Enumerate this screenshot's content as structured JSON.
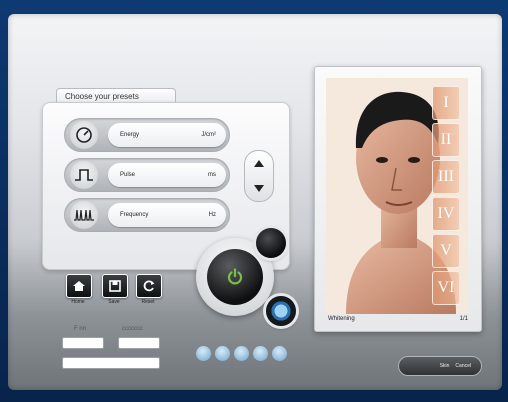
{
  "presets": {
    "tab_title": "Choose your presets",
    "rows": [
      {
        "icon": "gauge-icon",
        "label": "Energy",
        "value": "J/cm²"
      },
      {
        "icon": "pulse-wave-icon",
        "label": "Pulse",
        "value": "ms"
      },
      {
        "icon": "frequency-icon",
        "label": "Frequency",
        "value": "Hz"
      }
    ]
  },
  "nav": {
    "home_label": "Home",
    "save_label": "Save",
    "reset_label": "Reset"
  },
  "form": {
    "label_left": "F nn",
    "label_right": "ccccccc"
  },
  "photo": {
    "tabs": [
      "I",
      "II",
      "III",
      "IV",
      "V",
      "VI"
    ],
    "caption_left": "Whitening",
    "caption_right": "1/1"
  },
  "footer_button": {
    "left": "Skin",
    "right": "Cancel"
  },
  "progress_dots": 5,
  "colors": {
    "accent_green": "#7bc043",
    "dot_blue": "#8fb9da"
  }
}
